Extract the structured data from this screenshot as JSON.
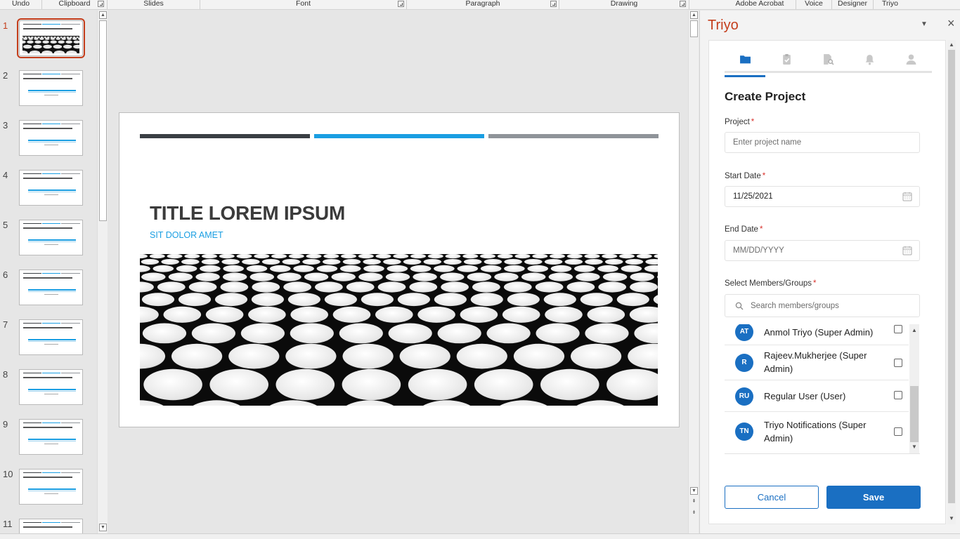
{
  "ribbon": {
    "groups": [
      "Undo",
      "Clipboard",
      "Slides",
      "Font",
      "Paragraph",
      "Drawing",
      "Adobe Acrobat",
      "Voice",
      "Designer",
      "Triyo"
    ]
  },
  "thumbnails": {
    "numbers": [
      "1",
      "2",
      "3",
      "4",
      "5",
      "6",
      "7",
      "8",
      "9",
      "10",
      "11"
    ],
    "selected": "1"
  },
  "slide": {
    "title": "TITLE LOREM IPSUM",
    "subtitle": "SIT DOLOR AMET",
    "bar_colors": [
      "#3a3f44",
      "#1a9ee2",
      "#8f9499"
    ]
  },
  "pane": {
    "title": "Triyo",
    "tabs": [
      {
        "icon": "folder-icon",
        "active": true
      },
      {
        "icon": "clipboard-check-icon",
        "active": false
      },
      {
        "icon": "document-search-icon",
        "active": false
      },
      {
        "icon": "bell-icon",
        "active": false
      },
      {
        "icon": "user-icon",
        "active": false
      }
    ],
    "form": {
      "heading": "Create Project",
      "project_label": "Project",
      "project_placeholder": "Enter project name",
      "start_label": "Start Date",
      "start_value": "11/25/2021",
      "end_label": "End Date",
      "end_placeholder": "MM/DD/YYYY",
      "members_label": "Select Members/Groups",
      "search_placeholder": "Search members/groups",
      "required_mark": "*"
    },
    "members": [
      {
        "initials": "AT",
        "name": "Anmol Triyo (Super Admin)",
        "checked": false
      },
      {
        "initials": "R",
        "name": "Rajeev.Mukherjee (Super Admin)",
        "checked": false
      },
      {
        "initials": "RU",
        "name": "Regular User (User)",
        "checked": false
      },
      {
        "initials": "TN",
        "name": "Triyo Notifications (Super Admin)",
        "checked": false
      }
    ],
    "buttons": {
      "cancel": "Cancel",
      "save": "Save"
    },
    "accent_color": "#1a6fc2",
    "title_color": "#c43e1c"
  }
}
